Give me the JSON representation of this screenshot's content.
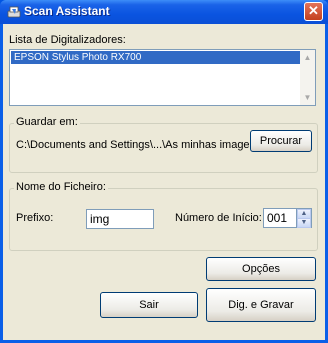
{
  "window": {
    "title": "Scan Assistant",
    "close_glyph": "✕"
  },
  "scanners": {
    "label": "Lista de Digitalizadores:",
    "items": [
      "EPSON Stylus Photo RX700"
    ]
  },
  "save": {
    "group_label": "Guardar em:",
    "path": "C:\\Documents and Settings\\...\\As minhas imagens",
    "browse_label": "Procurar"
  },
  "filename": {
    "group_label": "Nome do Ficheiro:",
    "prefix_label": "Prefixo:",
    "prefix_value": "img",
    "start_label": "Número de Início:",
    "start_value": "001"
  },
  "buttons": {
    "options": "Opções",
    "exit": "Sair",
    "scan_save": "Dig. e Gravar"
  },
  "icons": {
    "up": "▲",
    "down": "▼"
  }
}
